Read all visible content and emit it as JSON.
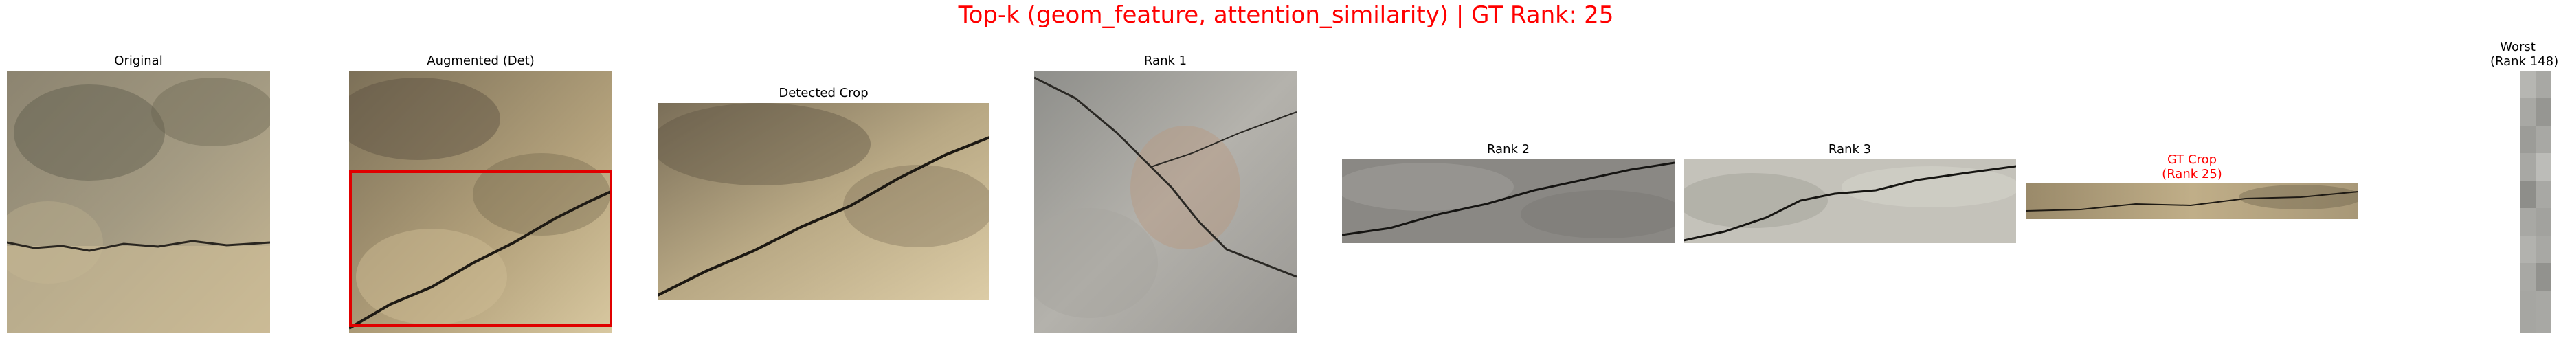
{
  "figure": {
    "title": "Top-k (geom_feature, attention_similarity) | GT Rank: 25",
    "title_color": "#ff0000"
  },
  "panels": [
    {
      "key": "original",
      "title": "Original",
      "title_color": "#000000"
    },
    {
      "key": "augmented",
      "title": "Augmented (Det)",
      "title_color": "#000000",
      "bbox_color": "#e00000"
    },
    {
      "key": "detected",
      "title": "Detected Crop",
      "title_color": "#000000"
    },
    {
      "key": "rank1",
      "title": "Rank 1",
      "title_color": "#000000"
    },
    {
      "key": "rank2",
      "title": "Rank 2",
      "title_color": "#000000"
    },
    {
      "key": "rank3",
      "title": "Rank 3",
      "title_color": "#000000"
    },
    {
      "key": "gt",
      "title_lines": [
        "GT Crop",
        "(Rank 25)"
      ],
      "title_color": "#ff0000"
    },
    {
      "key": "worst",
      "title_lines": [
        "Worst",
        "(Rank 148)"
      ],
      "title_color": "#000000"
    }
  ]
}
